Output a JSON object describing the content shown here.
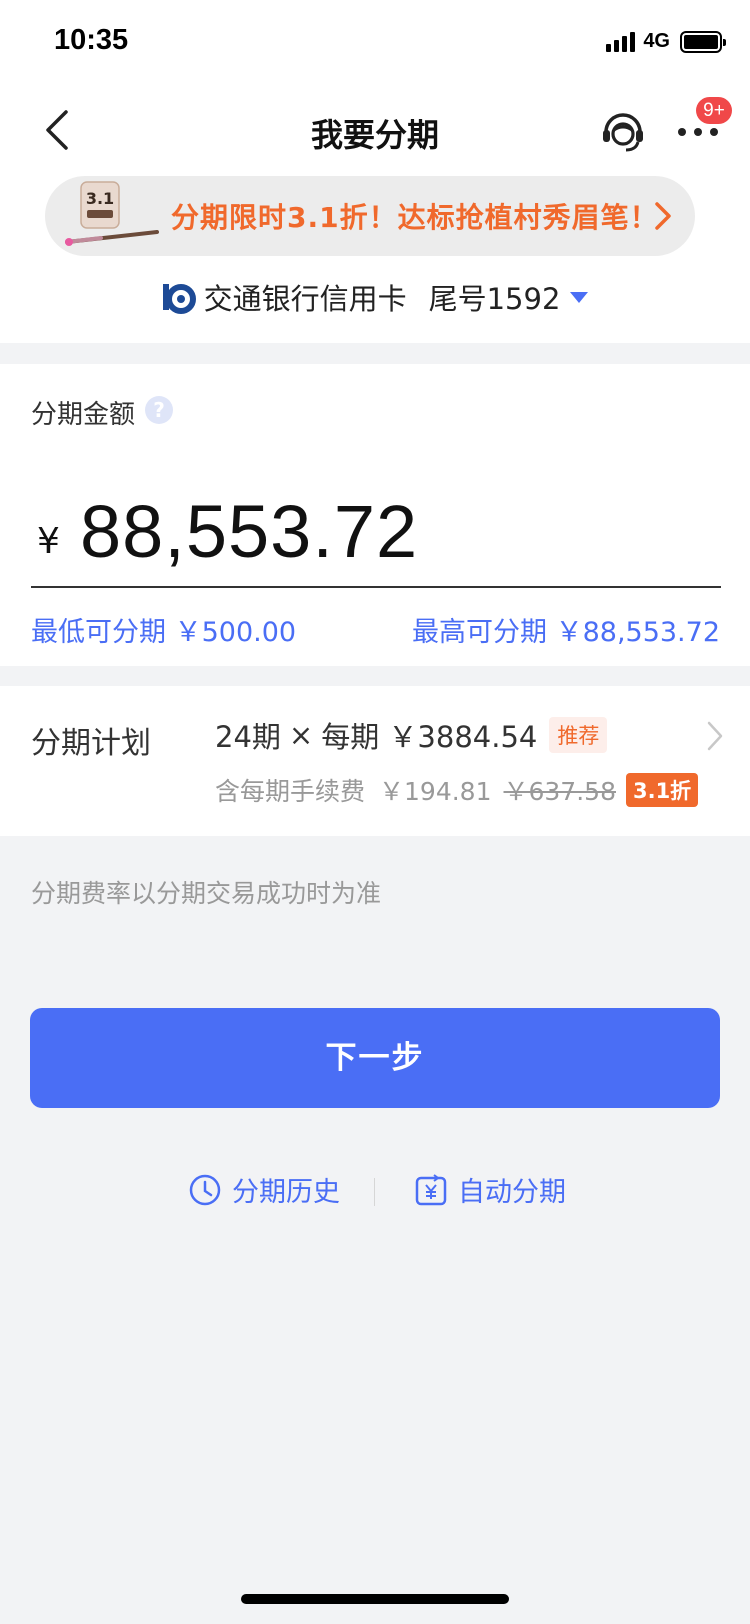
{
  "status_bar": {
    "time": "10:35",
    "network": "4G"
  },
  "nav": {
    "title": "我要分期",
    "badge": "9+"
  },
  "promo": {
    "text": "分期限时3.1折！达标抢植村秀眉笔！"
  },
  "card": {
    "bank_name": "交通银行信用卡",
    "tail": "尾号1592"
  },
  "amount": {
    "label": "分期金额",
    "help": "?",
    "currency": "¥",
    "value": "88,553.72",
    "min_text": "最低可分期 ￥500.00",
    "max_text": "最高可分期 ￥88,553.72"
  },
  "plan": {
    "label": "分期计划",
    "periods": "24期",
    "times": "×",
    "per_period": "每期 ￥3884.54",
    "recommend_tag": "推荐",
    "fee_label": "含每期手续费",
    "fee": "￥194.81",
    "original_fee": "￥637.58",
    "discount_tag": "3.1折"
  },
  "rate_note": "分期费率以分期交易成功时为准",
  "next_button": "下一步",
  "links": {
    "history": "分期历史",
    "auto": "自动分期"
  },
  "colors": {
    "accent": "#4a6ef5",
    "promo": "#f0692c",
    "badge": "#f04849"
  }
}
